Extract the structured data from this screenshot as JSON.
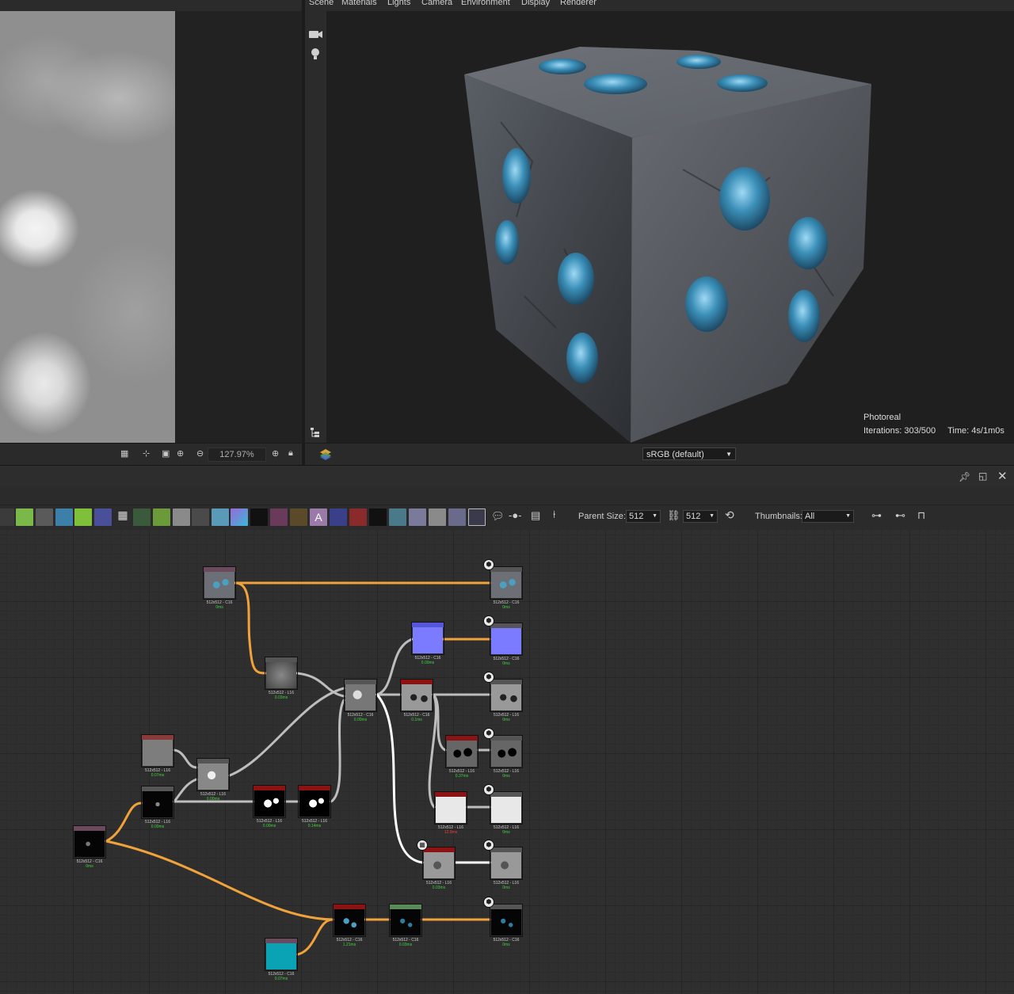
{
  "menu3d": [
    "Scene",
    "Materials",
    "Lights",
    "Camera",
    "Environment",
    "Display",
    "Renderer"
  ],
  "view2d": {
    "zoom": "127.97%"
  },
  "view3d": {
    "colorspace": "sRGB (default)",
    "render_mode": "Photoreal",
    "iterations": "Iterations: 303/500",
    "time": "Time: 4s/1m0s"
  },
  "graph_toolbar": {
    "parent_size_label": "Parent Size:",
    "parent_size": "512",
    "output_size": "512",
    "thumbnails_label": "Thumbnails:",
    "thumbnails": "All"
  },
  "colors": {
    "orange_link": "#f0a23b",
    "white_link": "#d0d0d0",
    "node_red": "#8b1313",
    "node_purple": "#6b4a5e",
    "node_green": "#5a8a5a"
  },
  "nodes": [
    {
      "id": "n1",
      "label": "512x512 - C16",
      "time": "0ms"
    },
    {
      "id": "n2",
      "label": "512x512 - L16",
      "time": "0.03ms"
    },
    {
      "id": "n3",
      "label": "512x512 - C16",
      "time": "0.00ms"
    },
    {
      "id": "n4",
      "label": "512x512 - C16",
      "time": "0.00ms"
    },
    {
      "id": "n5",
      "label": "512x512 - C16",
      "time": "0.1ms"
    },
    {
      "id": "n6",
      "label": "512x512 - L16",
      "time": "0.37ms"
    },
    {
      "id": "n7",
      "label": "512x512 - L16",
      "time": "12.0ms"
    },
    {
      "id": "n8",
      "label": "512x512 - L16",
      "time": "0.07ms"
    },
    {
      "id": "n9",
      "label": "512x512 - L16",
      "time": "0.00ms"
    },
    {
      "id": "n10",
      "label": "512x512 - L16",
      "time": "0.00ms"
    },
    {
      "id": "n11",
      "label": "512x512 - L16",
      "time": "0.00ms"
    },
    {
      "id": "n12",
      "label": "512x512 - L16",
      "time": "0.14ms"
    },
    {
      "id": "n13",
      "label": "512x512 - C16",
      "time": "0ms"
    },
    {
      "id": "n14",
      "label": "512x512 - L16",
      "time": "0.03ms"
    },
    {
      "id": "n15",
      "label": "512x512 - C16",
      "time": "1.21ms"
    },
    {
      "id": "n16",
      "label": "512x512 - C16",
      "time": "0.03ms"
    },
    {
      "id": "n17",
      "label": "512x512 - C16",
      "time": "0.07ms"
    },
    {
      "id": "o1",
      "label": "512x512 - C16",
      "time": "0ms"
    },
    {
      "id": "o2",
      "label": "512x512 - C16",
      "time": "0ms"
    },
    {
      "id": "o3",
      "label": "512x512 - L16",
      "time": "0ms"
    },
    {
      "id": "o4",
      "label": "512x512 - L16",
      "time": "0ms"
    },
    {
      "id": "o5",
      "label": "512x512 - L16",
      "time": "0ms"
    },
    {
      "id": "o6",
      "label": "512x512 - L16",
      "time": "0ms"
    },
    {
      "id": "o7",
      "label": "512x512 - C16",
      "time": "0ms"
    }
  ]
}
